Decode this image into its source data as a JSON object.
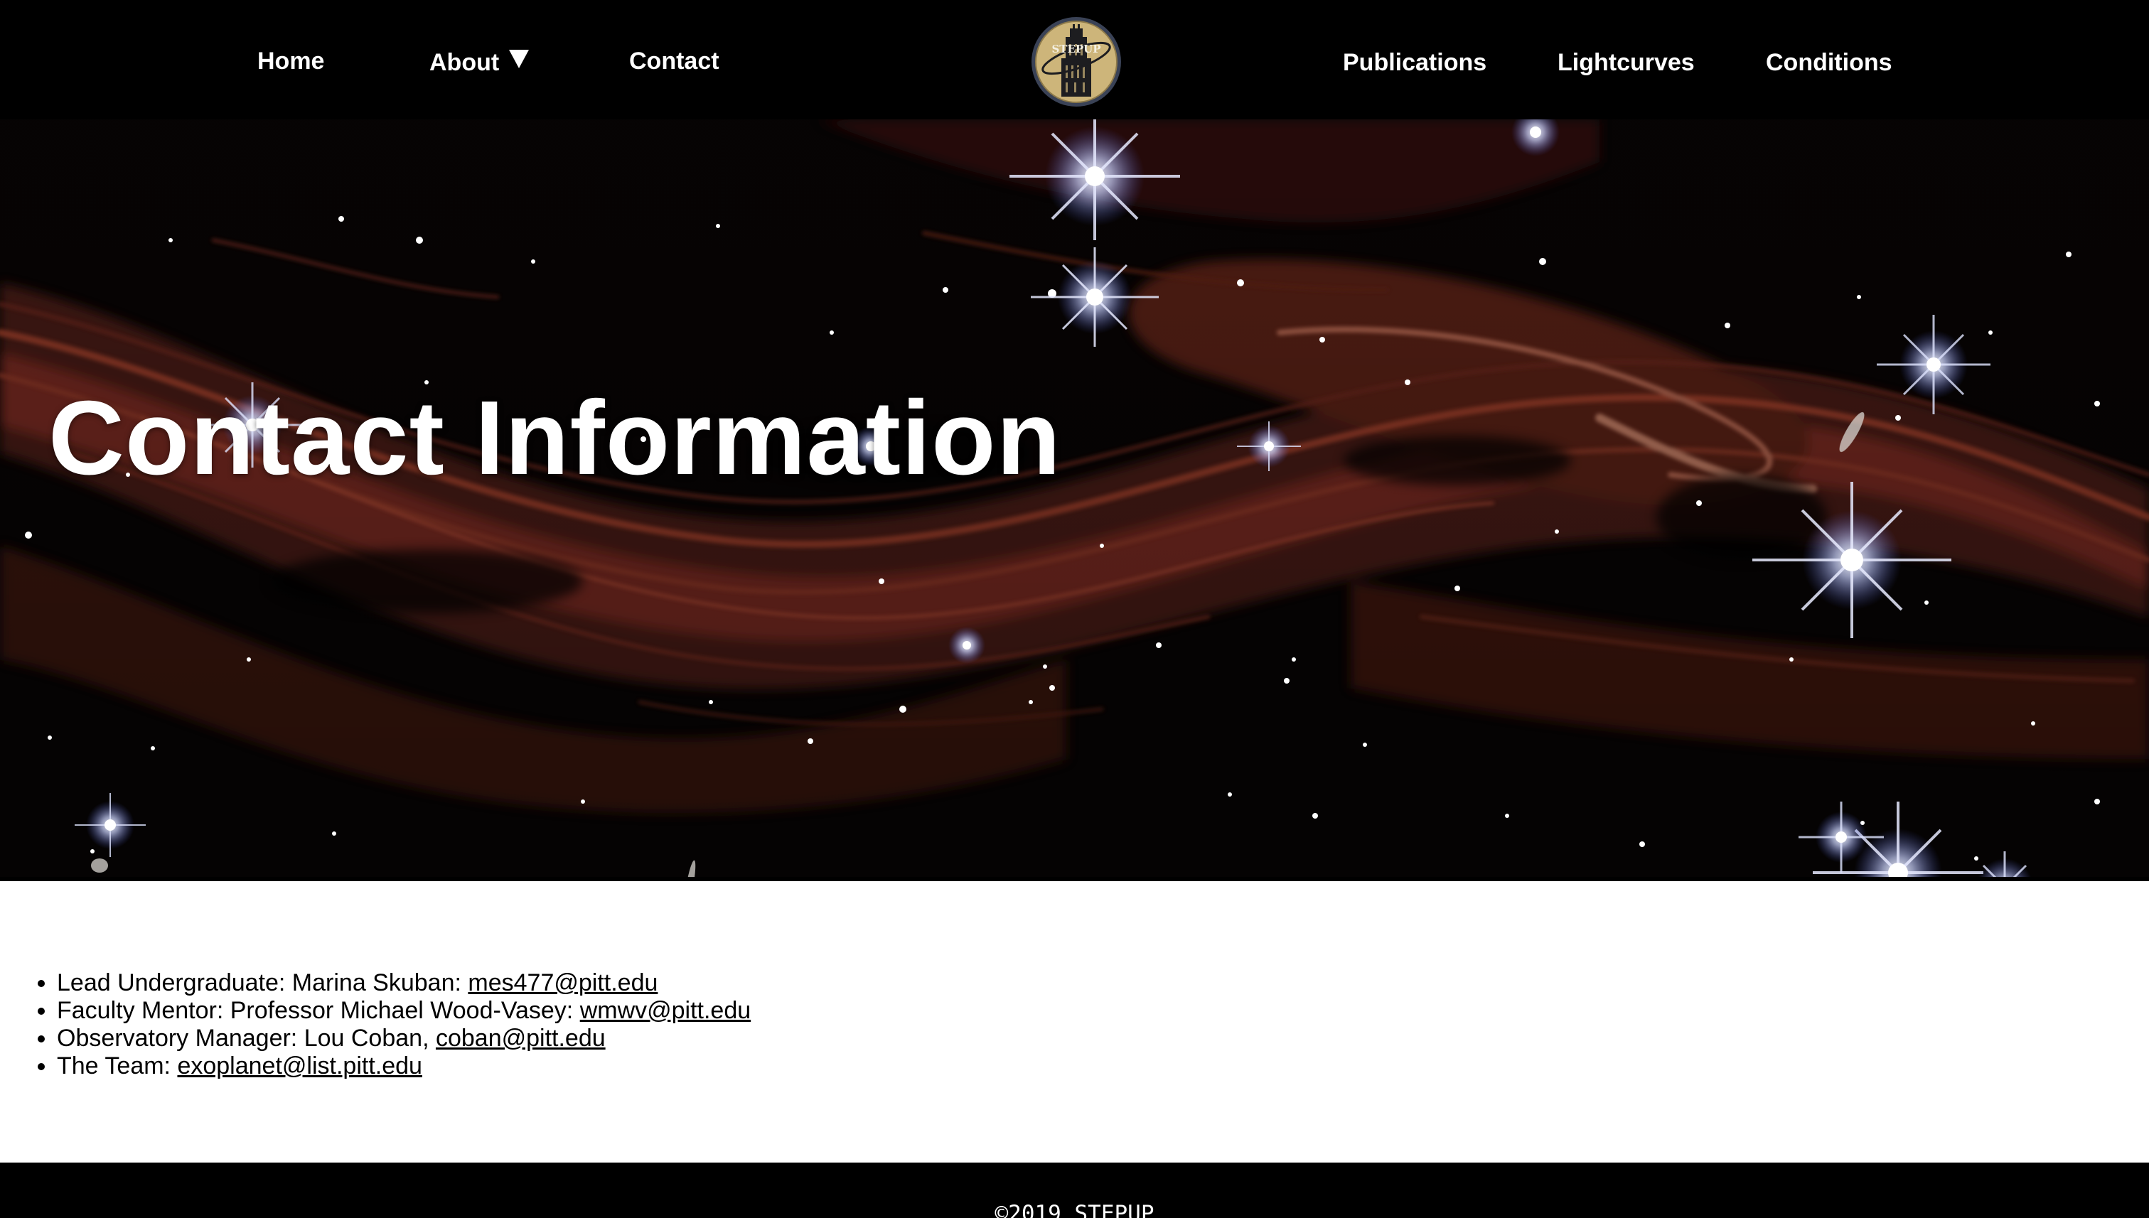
{
  "nav": {
    "home": "Home",
    "about": "About",
    "contact": "Contact",
    "publications": "Publications",
    "lightcurves": "Lightcurves",
    "conditions": "Conditions",
    "logo_text": "STEPUP",
    "caret_icon": "caret-down-icon"
  },
  "hero": {
    "title": "Contact Information",
    "background": "nebula-starfield-image"
  },
  "contacts": [
    {
      "label": "Lead Undergraduate: Marina Skuban: ",
      "email": "mes477@pitt.edu"
    },
    {
      "label": "Faculty Mentor: Professor Michael Wood-Vasey: ",
      "email": "wmwv@pitt.edu"
    },
    {
      "label": "Observatory Manager: Lou Coban, ",
      "email": "coban@pitt.edu"
    },
    {
      "label": "The Team: ",
      "email": "exoplanet@list.pitt.edu"
    }
  ],
  "footer": {
    "copyright": "©2019 STEPUP"
  },
  "colors": {
    "nav_bg": "#000000",
    "nav_text": "#ffffff",
    "logo_gold": "#cdb57a",
    "logo_ring": "#3a4256",
    "footer_bg": "#000000",
    "nebula_red": "#8a3224"
  }
}
